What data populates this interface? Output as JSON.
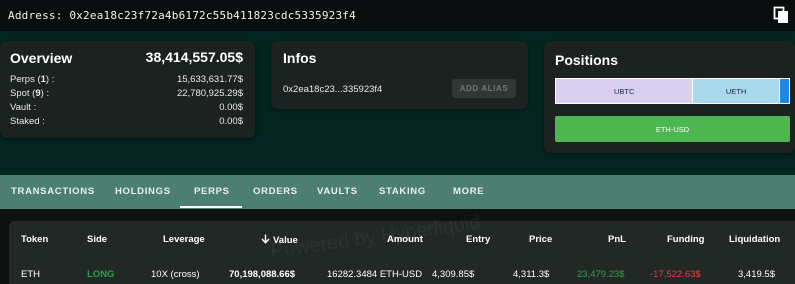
{
  "address_bar": {
    "label": "Address: 0x2ea18c23f72a4b6172c55b411823cdc5335923f4",
    "copy_icon": "copy-icon"
  },
  "overview": {
    "title": "Overview",
    "total": "38,414,557.05$",
    "rows": [
      {
        "label": "Perps (1) :",
        "value": "15,633,631.77$"
      },
      {
        "label": "Spot (9) :",
        "value": "22,780,925.29$"
      },
      {
        "label": "Vault :",
        "value": "0.00$"
      },
      {
        "label": "Staked :",
        "value": "0.00$"
      }
    ]
  },
  "infos": {
    "title": "Infos",
    "short_address": "0x2ea18c23...335923f4",
    "add_alias_label": "ADD ALIAS"
  },
  "positions": {
    "title": "Positions",
    "segments": [
      {
        "label": "UBTC",
        "share": 0.59,
        "color": "#d8d0ee"
      },
      {
        "label": "UETH",
        "share": 0.37,
        "color": "#a9d9ec"
      },
      {
        "label": "",
        "share": 0.04,
        "color": "#1e88e5"
      }
    ],
    "perp_bar": {
      "label": "ETH-USD",
      "color": "#4db651"
    }
  },
  "tabs": {
    "items": [
      "TRANSACTIONS",
      "HOLDINGS",
      "PERPS",
      "ORDERS",
      "VAULTS",
      "STAKING",
      "MORE"
    ],
    "active": "PERPS"
  },
  "table": {
    "headers": {
      "token": "Token",
      "side": "Side",
      "leverage": "Leverage",
      "value": "Value",
      "amount": "Amount",
      "entry": "Entry",
      "price": "Price",
      "pnl": "PnL",
      "funding": "Funding",
      "liquidation": "Liquidation"
    },
    "sort_icon": "arrow-down-icon",
    "rows": [
      {
        "token": "ETH",
        "side": "LONG",
        "leverage": "10X (cross)",
        "value": "70,198,088.66$",
        "amount": "16282.3484 ETH-USD",
        "entry": "4,309.85$",
        "price": "4,311.3$",
        "pnl": "23,479.23$",
        "funding": "-17,522.63$",
        "liquidation": "3,419.5$"
      }
    ]
  },
  "watermark": "Powered by Hyperliquid",
  "colors": {
    "background": "#04251f",
    "card": "#1b2220",
    "tabs": "#4c7e71",
    "positive": "#2ea043",
    "negative": "#f23b3b",
    "long": "#22a34a"
  }
}
